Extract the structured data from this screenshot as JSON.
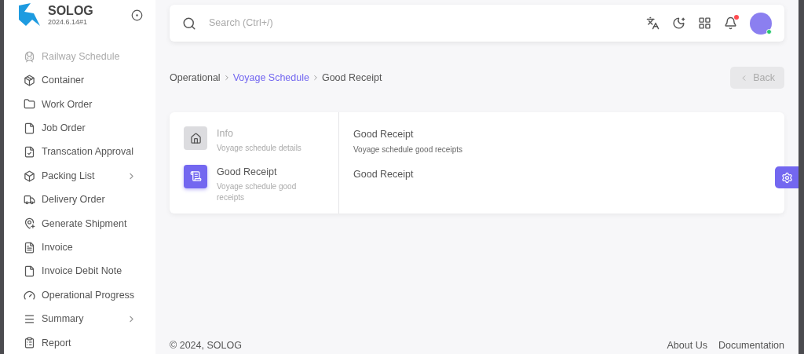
{
  "brand": {
    "name": "SOLOG",
    "version": "2024.6.14#1"
  },
  "sidebar": {
    "items": [
      {
        "label": "Railway Schedule",
        "kind": "link"
      },
      {
        "label": "Container",
        "kind": "link"
      },
      {
        "label": "Work Order",
        "kind": "link"
      },
      {
        "label": "Job Order",
        "kind": "link"
      },
      {
        "label": "Transcation Approval",
        "kind": "link"
      },
      {
        "label": "Packing List",
        "kind": "group"
      },
      {
        "label": "Delivery Order",
        "kind": "link"
      },
      {
        "label": "Generate Shipment",
        "kind": "link"
      },
      {
        "label": "Invoice",
        "kind": "link"
      },
      {
        "label": "Invoice Debit Note",
        "kind": "link"
      },
      {
        "label": "Operational Progress",
        "kind": "link"
      },
      {
        "label": "Summary",
        "kind": "group"
      },
      {
        "label": "Report",
        "kind": "link"
      }
    ]
  },
  "search": {
    "placeholder": "Search (Ctrl+/)"
  },
  "topbar": {
    "has_unread": true,
    "online": true
  },
  "breadcrumb": [
    {
      "label": "Operational",
      "link": false
    },
    {
      "label": "Voyage Schedule",
      "link": true
    },
    {
      "label": "Good Receipt",
      "link": false
    }
  ],
  "back_button": {
    "label": "Back",
    "disabled": true
  },
  "steps": [
    {
      "title": "Info",
      "subtitle": "Voyage schedule details",
      "selected": false
    },
    {
      "title": "Good Receipt",
      "subtitle": "Voyage schedule good receipts",
      "selected": true
    }
  ],
  "panel": {
    "title": "Good Receipt",
    "subtitle": "Voyage schedule good receipts",
    "body": "Good Receipt"
  },
  "footer": {
    "copyright": "© 2024, SOLOG",
    "links": [
      "About Us",
      "Documentation"
    ]
  }
}
